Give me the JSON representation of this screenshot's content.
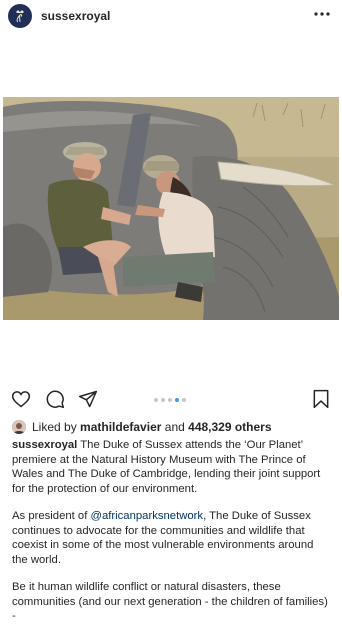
{
  "post": {
    "username": "sussexroyal",
    "more_icon": "more-horizontal-icon"
  },
  "photo": {
    "alt": "Prince Harry fitting a tracking collar to a sedated elephant"
  },
  "actions": {
    "like_icon": "heart-icon",
    "comment_icon": "comment-icon",
    "share_icon": "share-icon",
    "save_icon": "bookmark-icon",
    "carousel_total": 5,
    "carousel_active": 4
  },
  "likes": {
    "prefix": "Liked by",
    "liker": "mathildefavier",
    "middle": "and",
    "count_text": "448,329 others"
  },
  "caption": {
    "username": "sussexroyal",
    "p1": "The Duke of Sussex attends the ‘Our Planet’ premiere at the Natural History Museum with The Prince of Wales and The Duke of Cambridge, lending their joint support for the protection of our environment.",
    "p2_prefix": "As president of ",
    "p2_mention": "@africanparksnetwork",
    "p2_rest": ", The Duke of Sussex continues to advocate for the communities and wildlife that coexist in some of the most vulnerable environments around the world.",
    "p3": "Be it human wildlife conflict or natural disasters, these communities (and our next generation - the children of families) -"
  },
  "colors": {
    "text": "#262626",
    "mention": "#003569",
    "dot_active": "#3897f0",
    "dot_inactive": "#c7c7c7",
    "avatar_bg": "#1f2f55"
  }
}
